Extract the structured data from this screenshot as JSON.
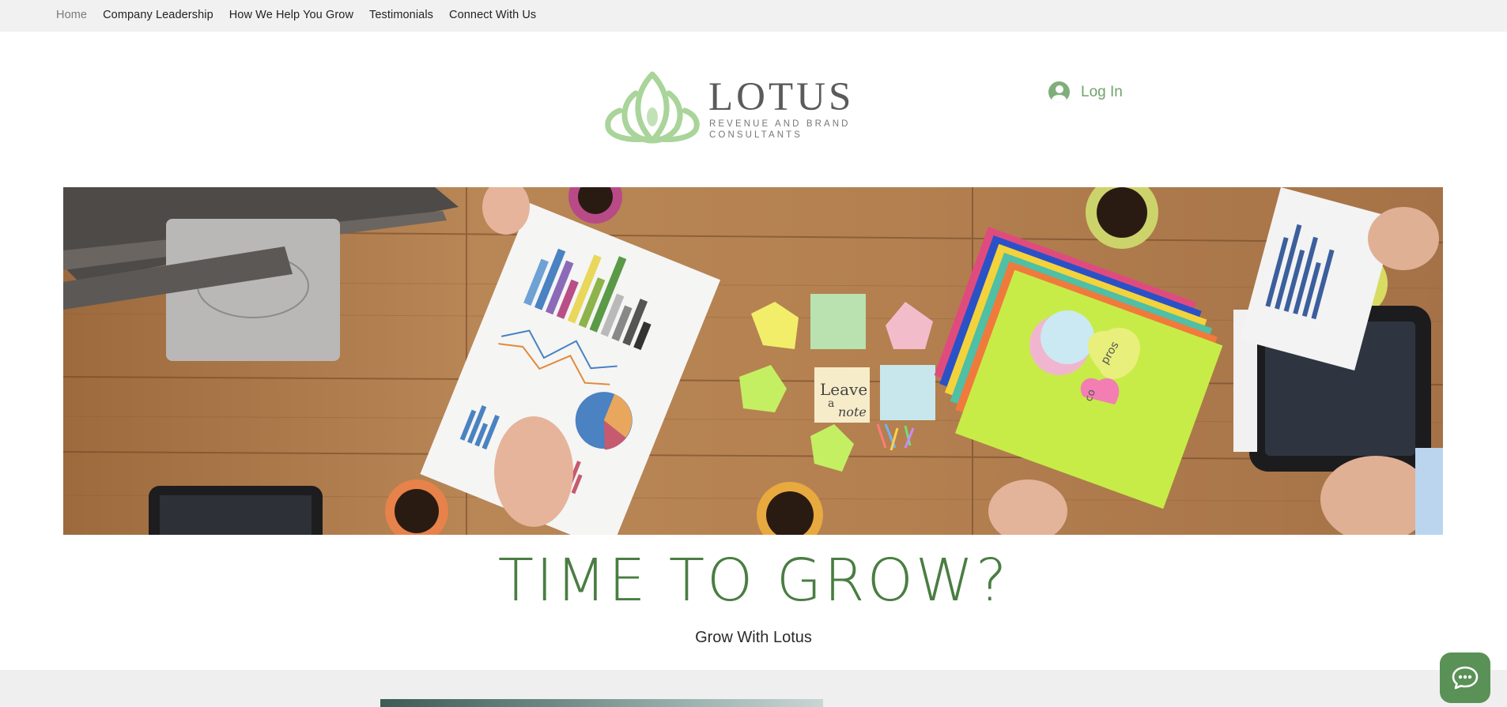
{
  "nav": {
    "items": [
      {
        "label": "Home",
        "active": true
      },
      {
        "label": "Company Leadership",
        "active": false
      },
      {
        "label": "How We Help You Grow",
        "active": false
      },
      {
        "label": "Testimonials",
        "active": false
      },
      {
        "label": "Connect With Us",
        "active": false
      }
    ]
  },
  "header": {
    "logo": {
      "name": "LOTUS",
      "tagline_line1": "REVENUE AND BRAND",
      "tagline_line2": "CONSULTANTS",
      "icon": "lotus-flower-icon",
      "icon_color": "#a9d49a"
    },
    "login": {
      "label": "Log In",
      "icon": "user-avatar-icon",
      "color": "#6ea36a"
    }
  },
  "hero": {
    "image_description_icon": "office-desk-photo",
    "note_text_line1": "Leave",
    "note_text_line2": "a",
    "note_text_line3": "note",
    "heart_text": "pros",
    "heart_text2": "co"
  },
  "main": {
    "headline": "TIME TO GROW?",
    "subheadline": "Grow With Lotus",
    "headline_color": "#4a7d42"
  },
  "chat": {
    "icon": "chat-bubble-icon",
    "color": "#5a9157"
  }
}
